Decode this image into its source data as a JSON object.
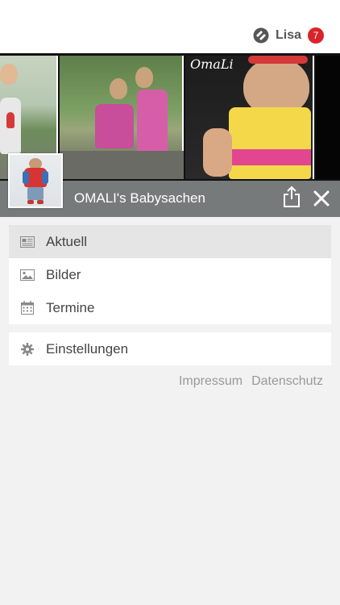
{
  "header": {
    "user_name": "Lisa",
    "notification_count": "7"
  },
  "banner": {
    "watermark": "OmaLi"
  },
  "page": {
    "title": "OMALI's Babysachen"
  },
  "menu": {
    "items": [
      {
        "label": "Aktuell",
        "icon": "newspaper-icon",
        "active": true
      },
      {
        "label": "Bilder",
        "icon": "image-icon",
        "active": false
      },
      {
        "label": "Termine",
        "icon": "calendar-icon",
        "active": false
      }
    ]
  },
  "settings": {
    "label": "Einstellungen",
    "icon": "gear-icon"
  },
  "footer": {
    "impressum": "Impressum",
    "datenschutz": "Datenschutz"
  },
  "colors": {
    "badge": "#d9232a",
    "titlebar": "#777a7b",
    "active_row": "#e5e5e5"
  }
}
